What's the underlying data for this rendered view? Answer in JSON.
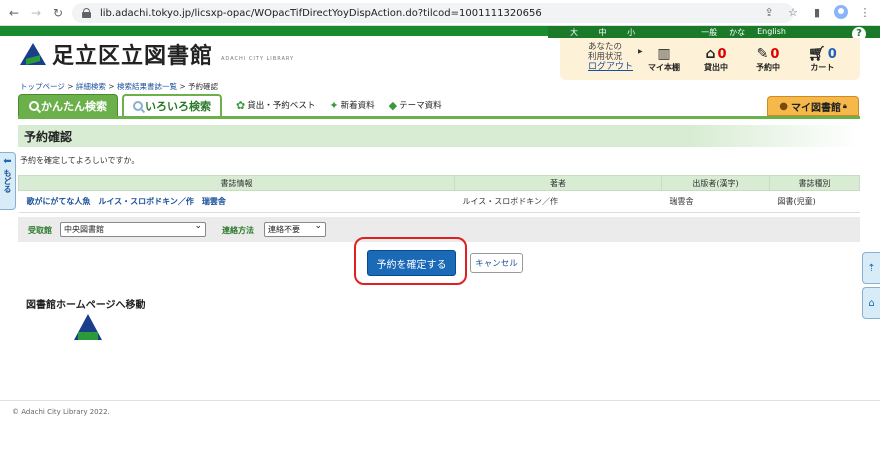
{
  "browser": {
    "url": "lib.adachi.tokyo.jp/licsxp-opac/WOpacTifDirectYoyDispAction.do?tilcod=1001111320656"
  },
  "util": {
    "size_large": "大",
    "size_medium": "中",
    "size_small": "小",
    "lang_general": "一般",
    "lang_kana": "かな",
    "lang_english": "English",
    "help": "?"
  },
  "logo": {
    "name": "足立区立図書館",
    "sub": "ADACHI CITY LIBRARY"
  },
  "account": {
    "status_line1": "あなたの",
    "status_line2": "利用状況",
    "logout": "ログアウト",
    "my_shelf": "マイ本棚",
    "borrowed": "貸出中",
    "borrowed_count": "0",
    "reserved": "予約中",
    "reserved_count": "0",
    "cart": "カート",
    "cart_count": "0"
  },
  "breadcrumb": {
    "top": "トップページ",
    "detail": "詳細検索",
    "results": "検索結果書誌一覧",
    "current": "予約確認"
  },
  "tabs": {
    "simple": "かんたん検索",
    "advanced": "いろいろ検索",
    "best": "貸出・予約ベスト",
    "new": "新着資料",
    "theme": "テーマ資料",
    "mylib": "マイ図書館"
  },
  "page": {
    "title": "予約確認",
    "message": "予約を確定してよろしいですか。"
  },
  "table": {
    "headers": [
      "書誌情報",
      "著者",
      "出版者(漢字)",
      "書誌種別"
    ],
    "row": {
      "title": "歌がにがてな人魚　ルイス・スロボドキン／作　瑞雲舎",
      "author": "ルイス・スロボドキン／作",
      "publisher": "瑞雲舎",
      "type": "図書(児童)"
    }
  },
  "form": {
    "pickup_label": "受取館",
    "pickup_value": "中央図書館",
    "contact_label": "連絡方法",
    "contact_value": "連絡不要"
  },
  "buttons": {
    "confirm": "予約を確定する",
    "cancel": "キャンセル"
  },
  "home_link": "図書館ホームページへ移動",
  "side": {
    "back": "もどる"
  },
  "footer": {
    "copyright": "© Adachi City Library 2022."
  }
}
